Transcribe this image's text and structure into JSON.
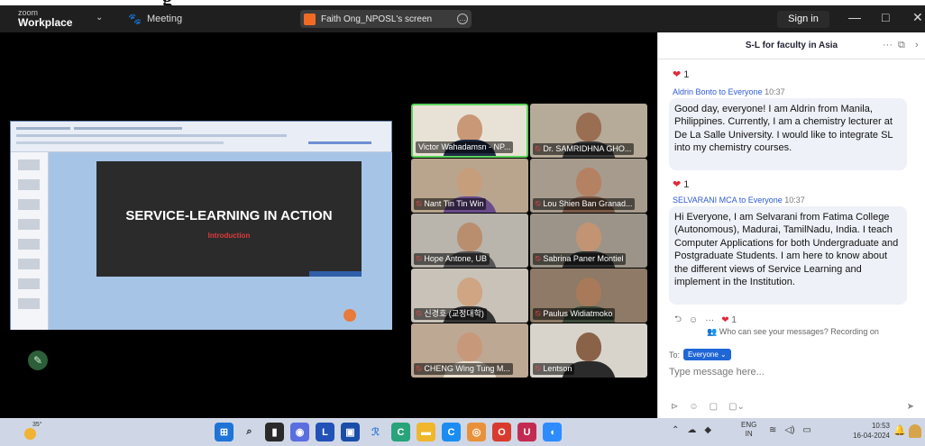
{
  "colors": {
    "titlebar": "#1f1f1f",
    "stage": "#000000",
    "accent": "#2d5bd2",
    "heart": "#e02a3a",
    "active_speaker": "#5ad35a",
    "taskbar": "#cfd7e6"
  },
  "titlebar": {
    "brand_small": "zoom",
    "brand": "Workplace",
    "meeting_label": "Meeting",
    "share_label": "Faith Ong_NPOSL's screen",
    "signin": "Sign in",
    "minimize": "—",
    "restore": "□",
    "close": "✕"
  },
  "slide": {
    "title": "SERVICE-LEARNING IN ACTION",
    "subtitle": "Introduction"
  },
  "gallery": [
    {
      "name": "Victor Wahadamsn - NP..."
    },
    {
      "name": "Dr. SAMRIDHNA GHO..."
    },
    {
      "name": "Nant Tin Tin Win"
    },
    {
      "name": "Lou Shien Ban Granad..."
    },
    {
      "name": "Hope Antone, UB"
    },
    {
      "name": "Sabrina Paner Montiel"
    },
    {
      "name": "신경호 (교정대학)"
    },
    {
      "name": "Paulus Widiatmoko"
    },
    {
      "name": "CHENG Wing Tung M..."
    },
    {
      "name": "Lentson"
    }
  ],
  "chat": {
    "title": "S-L for faculty in Asia",
    "messages": [
      {
        "reaction_count": "1",
        "sender": "Aldrin Bonto",
        "to_text": "to Everyone",
        "time": "10:37",
        "text": "Good day, everyone! I am Aldrin from Manila, Philippines. Currently, I am a chemistry lecturer at De La Salle University. I would like to integrate SL into my chemistry courses."
      },
      {
        "reaction_count": "1",
        "sender": "SELVARANI MCA",
        "to_text": "to Everyone",
        "time": "10:37",
        "text": "Hi Everyone, I am Selvarani from Fatima College (Autonomous), Madurai, TamilNadu, India. I teach Computer Applications for both Undergraduate and Postgraduate Students. I am here to know about the different views of Service Learning and implement in the Institution."
      }
    ],
    "last_reaction_count": "1",
    "visibility_note": "Who can see your messages? Recording on",
    "to_label": "To:",
    "to_value": "Everyone",
    "placeholder": "Type message here..."
  },
  "taskbar": {
    "temperature": "35°",
    "lang_top": "ENG",
    "lang_bottom": "IN",
    "time": "10:53",
    "date": "16-04-2024"
  }
}
